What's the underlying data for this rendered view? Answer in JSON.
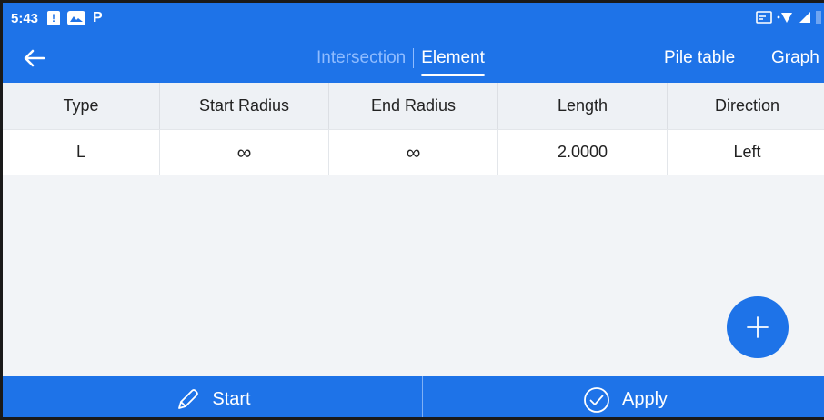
{
  "status_bar": {
    "time": "5:43",
    "left_icons": [
      "alert-icon",
      "photo-icon",
      "parking-icon"
    ],
    "parking_glyph": "P",
    "alert_glyph": "!",
    "right_icons": [
      "cast-icon",
      "wifi-icon",
      "signal-icon",
      "battery-icon"
    ]
  },
  "app_bar": {
    "tabs": [
      {
        "label": "Intersection",
        "active": false
      },
      {
        "label": "Element",
        "active": true
      }
    ],
    "actions": [
      {
        "label": "Pile table"
      },
      {
        "label": "Graph"
      }
    ]
  },
  "table": {
    "columns": [
      "Type",
      "Start Radius",
      "End Radius",
      "Length",
      "Direction"
    ],
    "rows": [
      [
        "L",
        "∞",
        "∞",
        "2.0000",
        "Left"
      ]
    ]
  },
  "bottom_bar": {
    "start_label": "Start",
    "apply_label": "Apply"
  },
  "colors": {
    "primary": "#1e73e8",
    "background": "#f2f4f7",
    "inactive_tab": "#8fbcff"
  }
}
